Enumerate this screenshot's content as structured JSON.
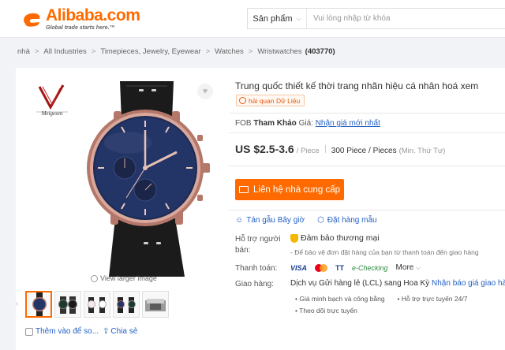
{
  "header": {
    "logo_word": "Alibaba.com",
    "logo_tagline": "Global trade starts here.™",
    "search": {
      "category": "Sản phẩm",
      "placeholder": "Vui lòng nhập từ khóa"
    }
  },
  "breadcrumb": {
    "items": [
      "nhà",
      "All Industries",
      "Timepieces, Jewelry, Eyewear",
      "Watches",
      "Wristwatches"
    ],
    "count": "(403770)"
  },
  "gallery": {
    "brand": "Meigesen",
    "view_larger": "View larger image",
    "thumb_count": 5,
    "active_thumb": 0,
    "compare_label": "Thêm vào để so...",
    "share_label": "Chia sẻ"
  },
  "product": {
    "title": "Trung quốc thiết kế thời trang nhãn hiệu cá nhân hoá xem",
    "assessed_badge": "hải quan Dữ Liệu",
    "fob_prefix": "FOB",
    "fob_bold": "Tham Khảo",
    "fob_suffix": "Giá:",
    "fob_link": "Nhận giá mới nhất",
    "price": "US $2.5-3.6",
    "price_unit": "/ Piece",
    "moq": "300 Piece / Pieces",
    "moq_note": "(Min. Thứ Tự)",
    "contact_button": "Liên hệ nhà cung cấp",
    "actions": {
      "chat": "Tán gẫu Bây giờ",
      "sample": "Đặt hàng mẫu"
    },
    "support_label": "Hỗ trợ người bán:",
    "assurance": "Đảm bảo thương mại",
    "assurance_note": "- Để bảo vệ đơn đặt hàng của bạn từ thanh toán đến giao hàng",
    "payment_label": "Thanh toán:",
    "payments": {
      "visa": "VISA",
      "tt": "TT",
      "echeck": "e-Checking",
      "more": "More"
    },
    "shipping_label": "Giao hàng:",
    "shipping_text": "Dịch vụ Gửi hàng lẻ (LCL) sang Hoa Kỳ",
    "shipping_link": "Nhận báo giá giao hàng",
    "bullets": {
      "b1": "• Giá minh bạch và công bằng",
      "b2": "• Hỗ trợ trực tuyến 24/7",
      "b3": "• Theo dõi trực tuyến"
    }
  },
  "colors": {
    "accent": "#ff6a00",
    "link": "#2461c4",
    "dial": "#1d2a52",
    "case": "#b5776a"
  }
}
